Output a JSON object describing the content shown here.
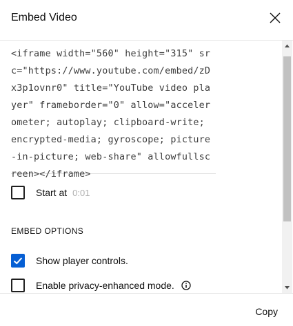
{
  "dialog": {
    "title": "Embed Video",
    "close_icon": "close-icon"
  },
  "embed": {
    "code": "<iframe width=\"560\" height=\"315\" src=\"https://www.youtube.com/embed/zDx3p1ovnr0\" title=\"YouTube video player\" frameborder=\"0\" allow=\"accelerometer; autoplay; clipboard-write; encrypted-media; gyroscope; picture-in-picture; web-share\" allowfullscreen></iframe>"
  },
  "start_at": {
    "label": "Start at",
    "time": "0:01",
    "checked": false
  },
  "embed_options": {
    "heading": "EMBED OPTIONS",
    "options": [
      {
        "label": "Show player controls.",
        "checked": true
      },
      {
        "label": "Enable privacy-enhanced mode.",
        "checked": false,
        "info_icon": "info-icon"
      }
    ]
  },
  "footer": {
    "copy_label": "Copy"
  },
  "colors": {
    "accent": "#065fd4",
    "divider": "#e6e6e6",
    "muted_text": "#b0b0b0"
  }
}
